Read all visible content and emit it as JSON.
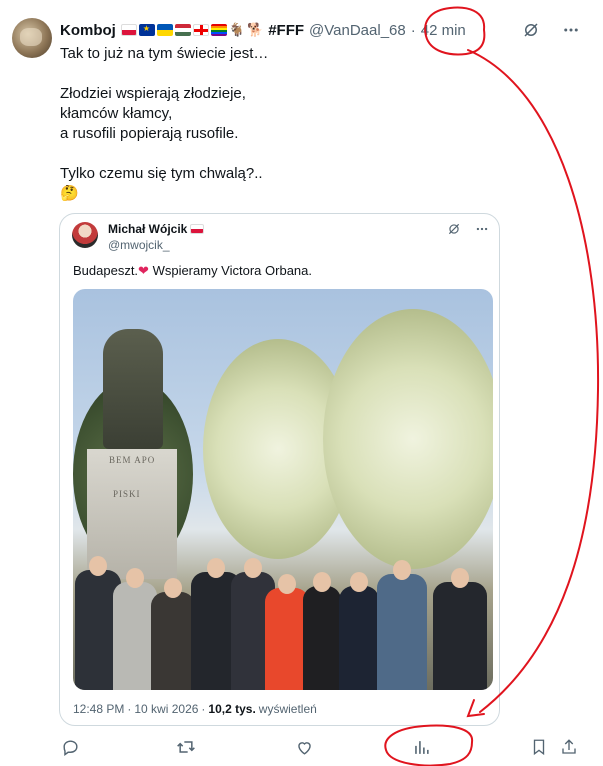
{
  "tweet": {
    "display_name": "Komboj",
    "fff": "#FFF",
    "handle": "@VanDaal_68",
    "dot": "·",
    "time": "42 min",
    "text": "Tak to już na tym świecie jest…\n\nZłodziei wspierają złodzieje,\nkłamców kłamcy,\na rusofili popierają rusofile.\n\nTylko czemu się tym chwalą?..\n🤔"
  },
  "quote": {
    "name": "Michał Wójcik",
    "handle": "@mwojcik_",
    "text_before": "Budapeszt.",
    "heart": "❤",
    "text_after": " Wspieramy Victora Orbana.",
    "photo_text_top": "BEM APO",
    "photo_text_mid": "PISKI",
    "time": "12:48 PM",
    "dot": "·",
    "date": "10 kwi 2026",
    "dot2": "·",
    "views": "10,2 tys.",
    "views_label": "wyświetleń"
  },
  "icons": {
    "grok": "grok-icon",
    "more": "more-icon",
    "reply": "reply-icon",
    "retweet": "retweet-icon",
    "like": "like-icon",
    "views": "views-icon",
    "bookmark": "bookmark-icon",
    "share": "share-icon"
  },
  "colors": {
    "annotation": "#e0141e",
    "heart": "#e0245e",
    "secondary_text": "#536471"
  }
}
